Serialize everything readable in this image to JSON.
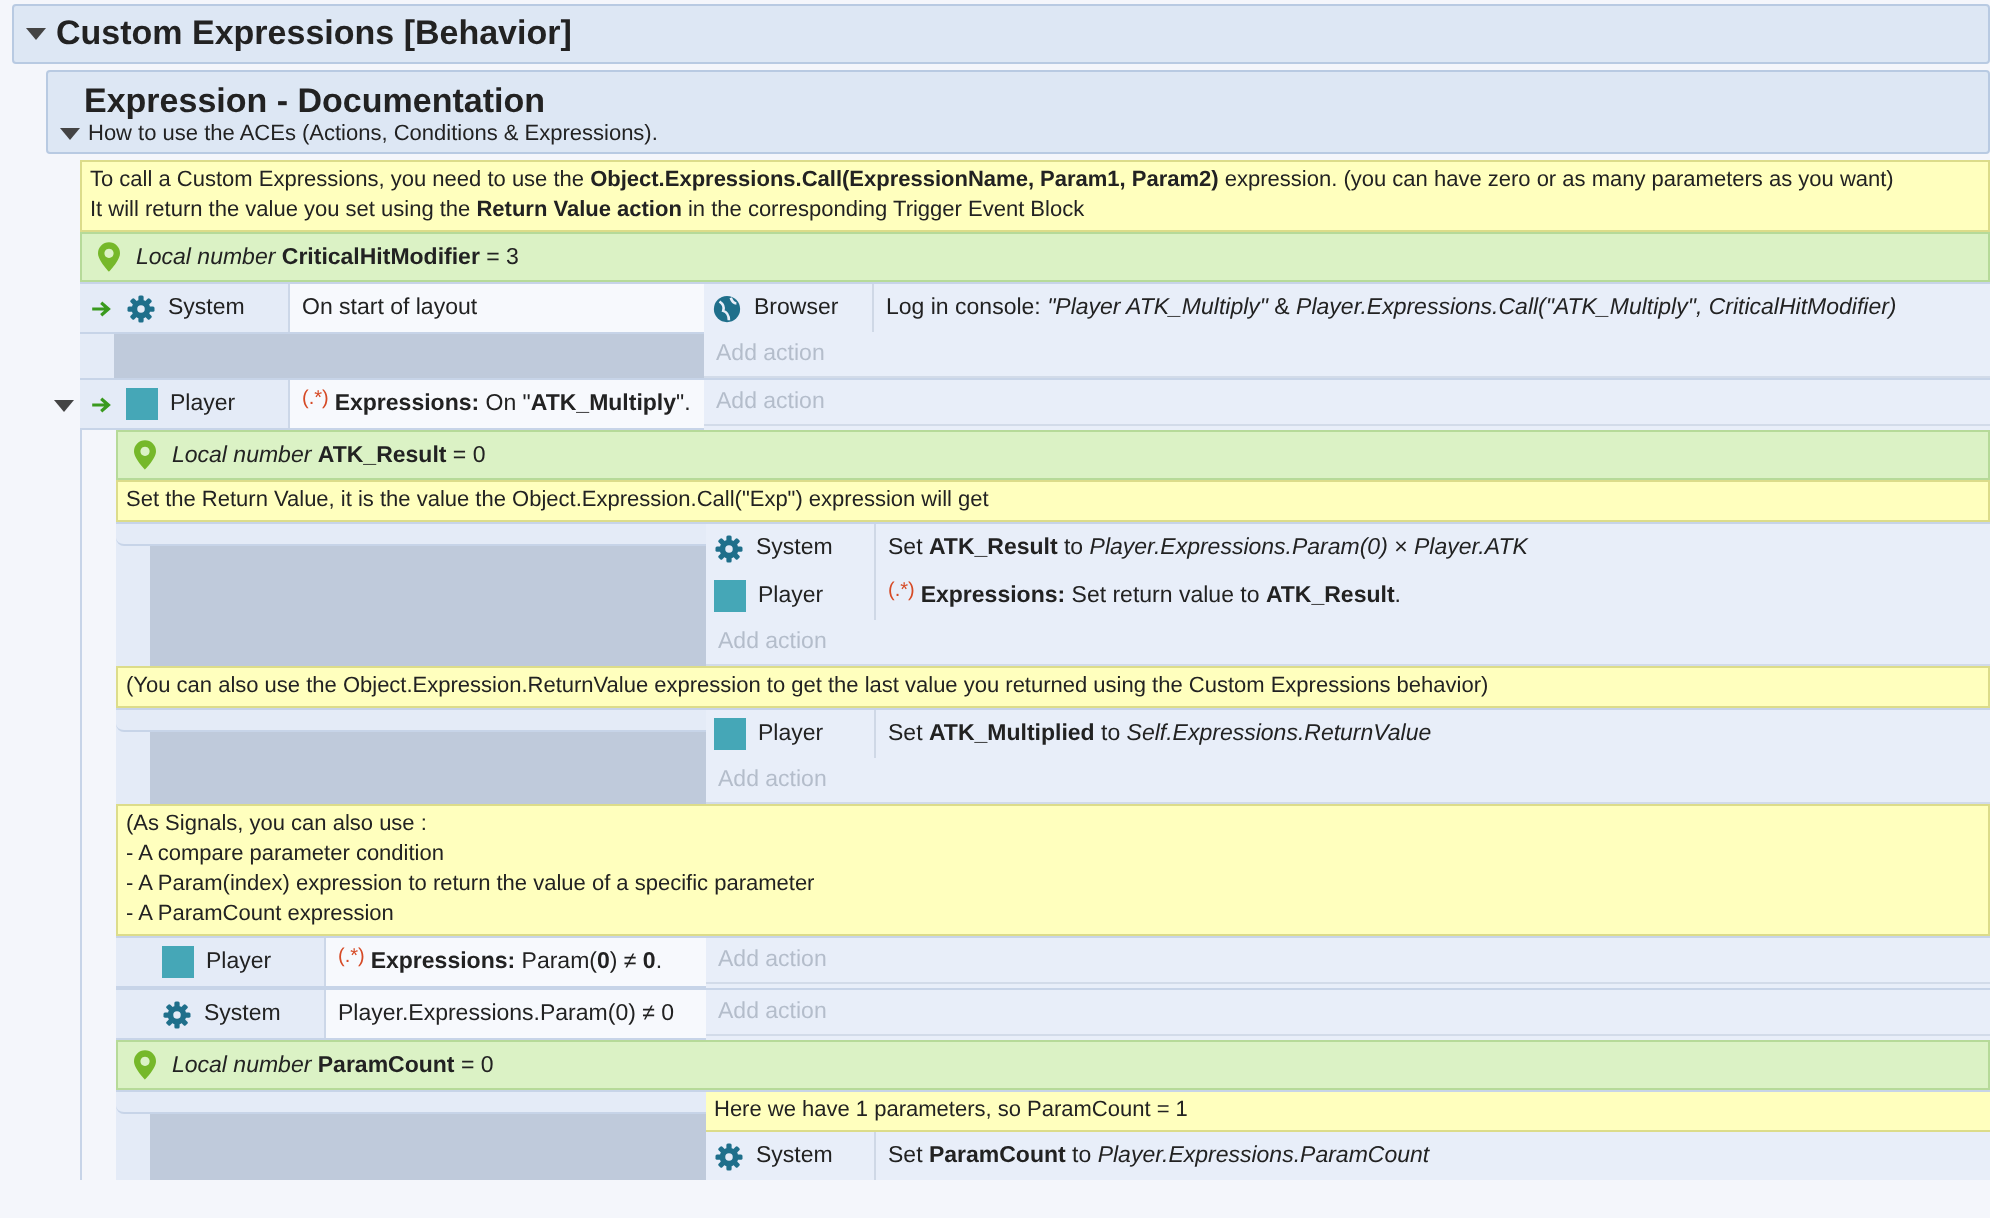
{
  "sheet": [
    {
      "kind": "group",
      "title": "Custom Expressions [Behavior]",
      "expanded": true,
      "children": [
        {
          "kind": "group",
          "title": "Expression - Documentation",
          "description": "How to use the ACEs (Actions, Conditions & Expressions).",
          "expanded": true,
          "children": [
            {
              "kind": "comment",
              "lines": [
                "To call a Custom Expressions, you need to use the **Object.Expressions.Call(ExpressionName, Param1, Param2)** expression. (you can have zero or as many parameters as you want)",
                "It will return the value you set using the **Return Value action** in the corresponding Trigger Event Block"
              ]
            },
            {
              "kind": "variable",
              "text": "*Local number* **CriticalHitModifier** = 3"
            },
            {
              "kind": "event",
              "trigger": true,
              "conditions": [
                {
                  "kind": "system",
                  "object": "System",
                  "text": "On start of layout"
                }
              ],
              "actions": [
                {
                  "kind": "browser",
                  "object": "Browser",
                  "text": "Log in console: *\"Player ATK_Multiply\"* & *Player.Expressions.Call(\"ATK_Multiply\", CriticalHitModifier)*"
                }
              ],
              "add_action": "Add action"
            },
            {
              "kind": "event",
              "trigger": true,
              "expanded": true,
              "conditions": [
                {
                  "kind": "sprite",
                  "object": "Player",
                  "behavior_mark": "(.*)",
                  "text": "**Expressions:** On \"**ATK_Multiply**\"."
                }
              ],
              "add_action": "Add action",
              "children": [
                {
                  "kind": "variable",
                  "text": "*Local number* **ATK_Result** = 0"
                },
                {
                  "kind": "comment",
                  "lines": [
                    "Set the Return Value, it is the value the Object.Expression.Call(\"Exp\") expression will get"
                  ]
                },
                {
                  "kind": "event",
                  "actions": [
                    {
                      "kind": "system",
                      "object": "System",
                      "text": "Set **ATK_Result** to *Player.Expressions.Param(0)* × *Player.ATK*"
                    },
                    {
                      "kind": "sprite",
                      "object": "Player",
                      "behavior_mark": "(.*)",
                      "text": "**Expressions:** Set return value to **ATK_Result**."
                    }
                  ],
                  "add_action": "Add action"
                },
                {
                  "kind": "comment",
                  "lines": [
                    "(You can also use the Object.Expression.ReturnValue expression to get the last value you returned  using the Custom Expressions behavior)"
                  ]
                },
                {
                  "kind": "event",
                  "actions": [
                    {
                      "kind": "sprite",
                      "object": "Player",
                      "text": "Set **ATK_Multiplied** to *Self.Expressions.ReturnValue*"
                    }
                  ],
                  "add_action": "Add action"
                },
                {
                  "kind": "comment",
                  "lines": [
                    "(As Signals, you can also use :",
                    "- A compare parameter condition",
                    "- A Param(index) expression to return the value of a specific parameter",
                    "- A ParamCount expression"
                  ]
                },
                {
                  "kind": "event",
                  "conditions": [
                    {
                      "kind": "sprite",
                      "object": "Player",
                      "behavior_mark": "(.*)",
                      "text": "**Expressions:** Param(**0**) ≠ **0**."
                    }
                  ],
                  "add_action": "Add action"
                },
                {
                  "kind": "event",
                  "conditions": [
                    {
                      "kind": "system",
                      "object": "System",
                      "text": "Player.Expressions.Param(0) ≠ 0"
                    }
                  ],
                  "add_action": "Add action"
                },
                {
                  "kind": "variable",
                  "text": "*Local number* **ParamCount** = 0"
                },
                {
                  "kind": "event",
                  "actions": [
                    {
                      "kind": "comment",
                      "text": "Here we have 1 parameters, so ParamCount = 1"
                    },
                    {
                      "kind": "system",
                      "object": "System",
                      "text": "Set **ParamCount** to *Player.Expressions.ParamCount*"
                    }
                  ]
                }
              ]
            }
          ]
        }
      ]
    }
  ]
}
